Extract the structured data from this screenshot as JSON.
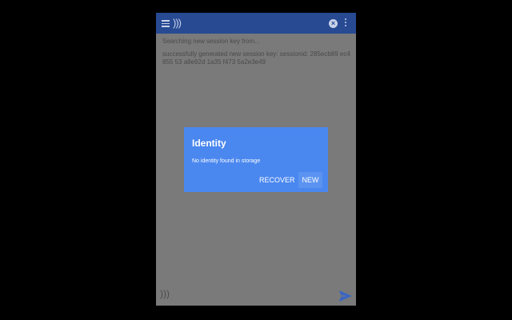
{
  "appbar": {
    "logo_text": ")))",
    "close_icon_glyph": "×",
    "icons": [
      "menu-icon",
      "app-logo-icon",
      "close-icon",
      "more-vert-icon"
    ]
  },
  "log": {
    "line1": "Searching new session key from...",
    "line1_ts": "",
    "line2": "successfully generated new session key: sessionid: 285ecb89 ec4855 53 a8e92d 1a35 f473 5a2e3e49",
    "line2_ts": ""
  },
  "composer": {
    "input_icon": ")))",
    "send_icon": "send-icon"
  },
  "dialog": {
    "title": "Identity",
    "message": "No identity found in storage",
    "recover_label": "RECOVER",
    "new_label": "NEW"
  },
  "colors": {
    "appbar": "#274a93",
    "dialog": "#4a87ef",
    "overlay": "#7a7a7a",
    "background": "#000000"
  }
}
